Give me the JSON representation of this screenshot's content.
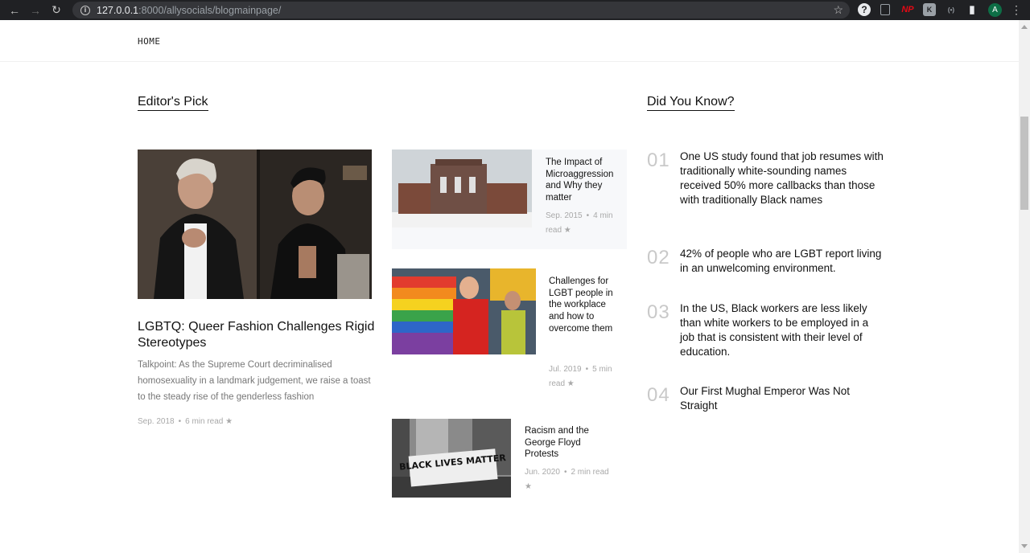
{
  "browser": {
    "url_host": "127.0.0.1",
    "url_path": ":8000/allysocials/blogmainpage/",
    "avatar_letter": "A",
    "ext_np": "NP",
    "ext_k": "K",
    "ext_dots": "(•)"
  },
  "nav": {
    "home": "HOME"
  },
  "editors_pick": {
    "title": "Editor's Pick",
    "featured": {
      "title": "LGBTQ: Queer Fashion Challenges Rigid Stereotypes",
      "excerpt": "Talkpoint: As the Supreme Court decriminalised homosexuality in a landmark judgement, we raise a toast to the steady rise of the genderless fashion",
      "date": "Sep. 2018",
      "read": "6 min read"
    },
    "cards": [
      {
        "title": "The Impact of Microaggression and Why they matter",
        "date": "Sep. 2015",
        "read": "4 min read"
      },
      {
        "title": "Challenges for LGBT people in the workplace and how to overcome them",
        "date": "Jul. 2019",
        "read": "5 min read"
      },
      {
        "title": "Racism and the George Floyd Protests",
        "date": "Jun. 2020",
        "read": "2 min read"
      }
    ],
    "image_texts": {
      "sign": "BLACK LIVES MATTER"
    }
  },
  "did_you_know": {
    "title": "Did You Know?",
    "facts": [
      {
        "num": "01",
        "text": "One US study found that job resumes with traditionally white-sounding names received 50% more callbacks than those with traditionally Black names"
      },
      {
        "num": "02",
        "text": "42% of people who are LGBT report living in an unwelcoming environment."
      },
      {
        "num": "03",
        "text": "In the US, Black workers are less likely than white workers to be employed in a job that is consistent with their level of education."
      },
      {
        "num": "04",
        "text": "Our First Mughal Emperor Was Not Straight"
      }
    ]
  },
  "colors": {
    "chrome": "#202124",
    "omnibox": "#35363a",
    "card_bg": "#f7f8fa",
    "muted": "#a9a9a9",
    "number": "#c9c9c9"
  }
}
